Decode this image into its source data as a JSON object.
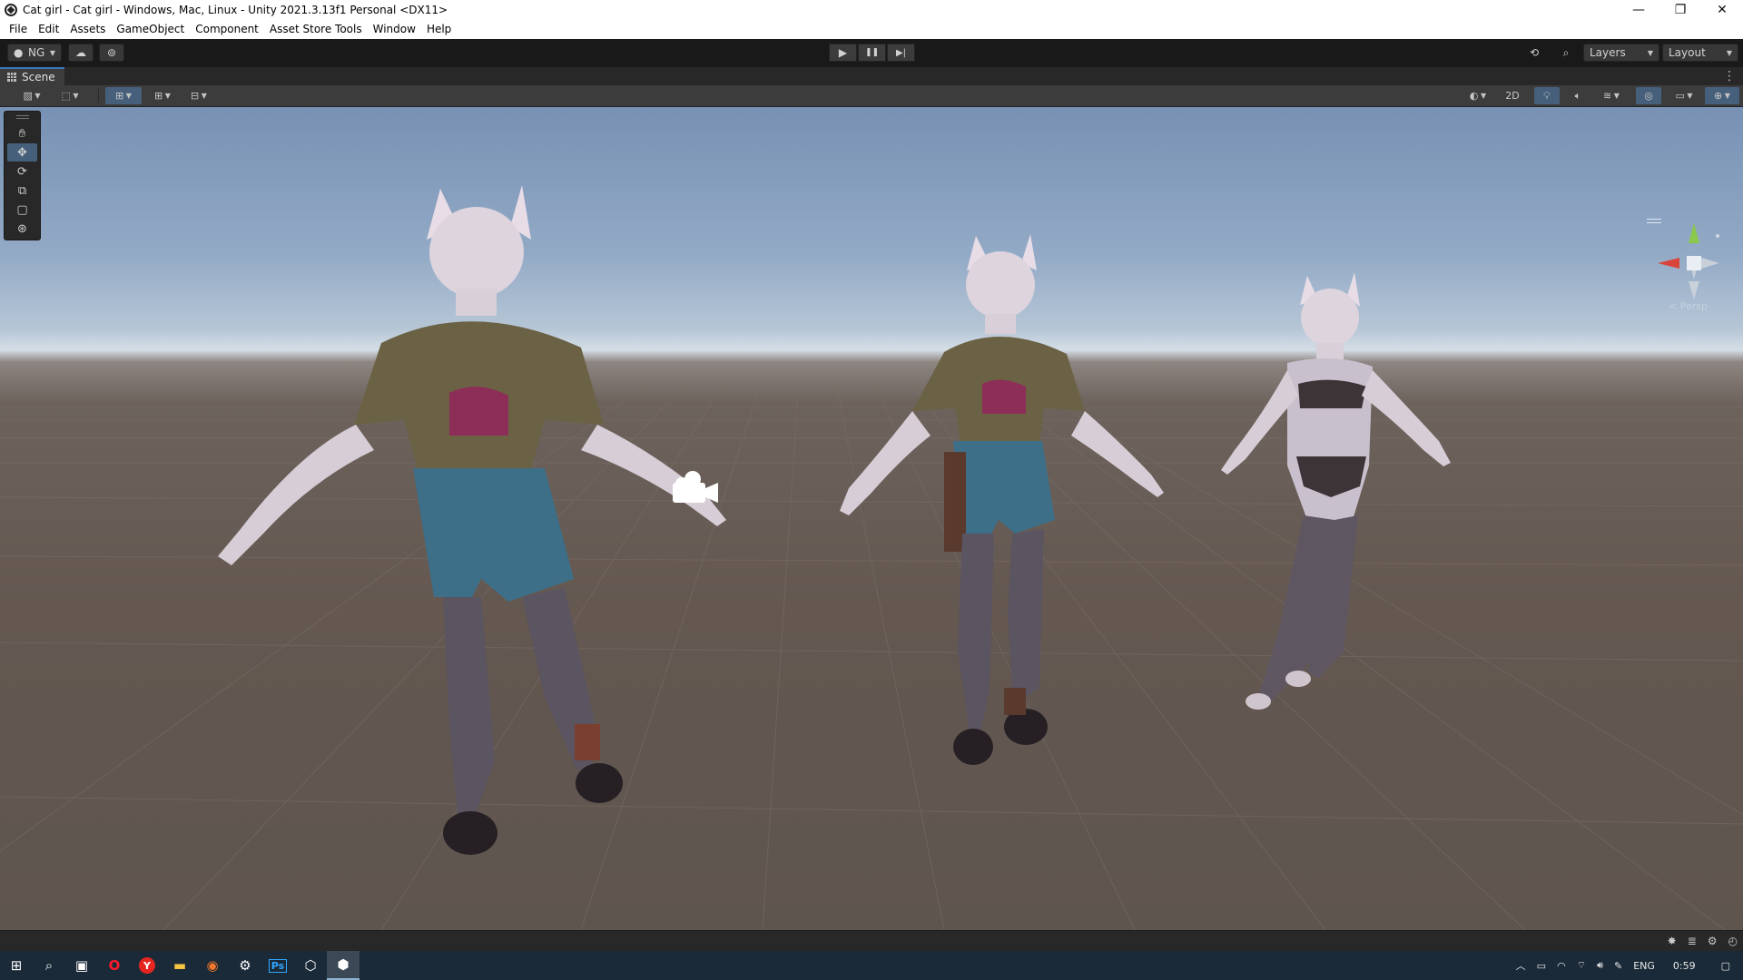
{
  "window": {
    "title": "Cat girl - Cat girl - Windows, Mac, Linux - Unity 2021.3.13f1 Personal <DX11>",
    "controls": {
      "minimize": "—",
      "restore": "❐",
      "close": "✕"
    }
  },
  "menu": [
    "File",
    "Edit",
    "Assets",
    "GameObject",
    "Component",
    "Asset Store Tools",
    "Window",
    "Help"
  ],
  "toolbar": {
    "account_label": "NG",
    "layers_label": "Layers",
    "layout_label": "Layout",
    "play_icons": {
      "play": "▶",
      "pause": "❚❚",
      "step": "▶|"
    }
  },
  "scene": {
    "tab_label": "Scene",
    "mode_2d_label": "2D",
    "projection_label": "< Persp",
    "active_tool": "move",
    "tools": [
      "hand-tool",
      "move-tool",
      "rotate-tool",
      "scale-tool",
      "rect-tool",
      "transform-tool"
    ]
  },
  "taskbar": {
    "apps": [
      {
        "name": "windows-start",
        "glyph": "⊞",
        "color": "#ffffff"
      },
      {
        "name": "search",
        "glyph": "⌕",
        "color": "#ffffff"
      },
      {
        "name": "task-view",
        "glyph": "▣",
        "color": "#ffffff"
      },
      {
        "name": "opera",
        "glyph": "O",
        "color": "#ff1b2d"
      },
      {
        "name": "yandex-browser",
        "glyph": "Y",
        "color": "#ff3333"
      },
      {
        "name": "file-explorer",
        "glyph": "▬",
        "color": "#f5c542"
      },
      {
        "name": "blender",
        "glyph": "◉",
        "color": "#f5792a"
      },
      {
        "name": "settings",
        "glyph": "⚙",
        "color": "#ffffff"
      },
      {
        "name": "photoshop",
        "glyph": "Ps",
        "color": "#31a8ff"
      },
      {
        "name": "unity-hub",
        "glyph": "⬡",
        "color": "#ffffff"
      },
      {
        "name": "unity-editor",
        "glyph": "⬢",
        "color": "#ffffff"
      }
    ],
    "language": "ENG",
    "time": "0:59"
  }
}
